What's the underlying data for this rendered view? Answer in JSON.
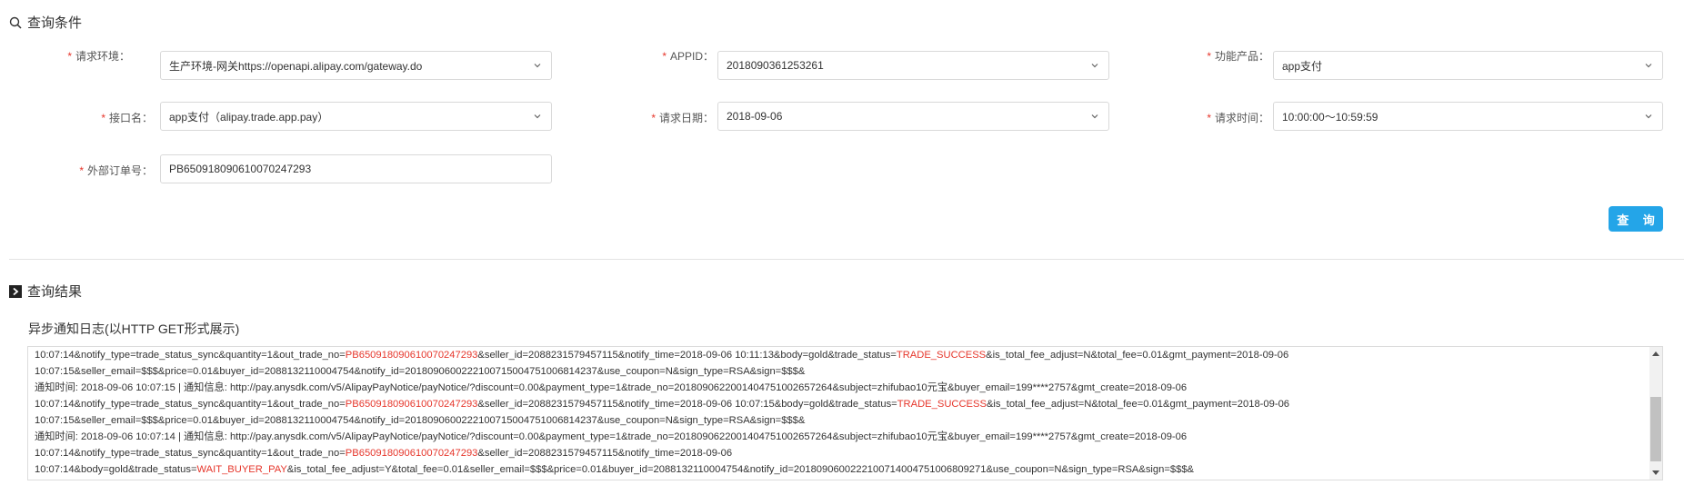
{
  "query_section": {
    "title": "查询条件",
    "fields": [
      {
        "required_mark": "*",
        "label": "请求环境：",
        "value": "生产环境-网关https://openapi.alipay.com/gateway.do",
        "type": "select"
      },
      {
        "required_mark": "*",
        "label": "APPID：",
        "value": "2018090361253261",
        "type": "select"
      },
      {
        "required_mark": "*",
        "label": "功能产品：",
        "value": "app支付",
        "type": "select"
      },
      {
        "required_mark": "*",
        "label": "接口名：",
        "value": "app支付（alipay.trade.app.pay）",
        "type": "select"
      },
      {
        "required_mark": "*",
        "label": "请求日期：",
        "value": "2018-09-06",
        "type": "select"
      },
      {
        "required_mark": "*",
        "label": "请求时间：",
        "value": "10:00:00～10:59:59",
        "type": "select"
      },
      {
        "required_mark": "*",
        "label": "外部订单号：",
        "value": "PB650918090610070247293",
        "type": "input"
      }
    ],
    "query_button": "查 询"
  },
  "result_section": {
    "title": "查询结果",
    "log_label": "异步通知日志(以HTTP GET形式展示)",
    "log_lines": [
      {
        "pre": "10:07:14&notify_type=trade_status_sync&quantity=1&out_trade_no=",
        "hl1": "PB650918090610070247293",
        "mid": "&seller_id=2088231579457115&notify_time=2018-09-06 10:11:13&body=gold&trade_status=",
        "hl2": "TRADE_SUCCESS",
        "post": "&is_total_fee_adjust=N&total_fee=0.01&gmt_payment=2018-09-06"
      },
      {
        "pre": "10:07:15&seller_email=$$$&price=0.01&buyer_id=2088132110004754&notify_id=2018090600222100715004751006814237&use_coupon=N&sign_type=RSA&sign=$$$&",
        "hl1": "",
        "mid": "",
        "hl2": "",
        "post": ""
      },
      {
        "pre": "通知时间: 2018-09-06 10:07:15 | 通知信息: http://pay.anysdk.com/v5/AlipayPayNotice/payNotice/?discount=0.00&payment_type=1&trade_no=2018090622001404751002657264&subject=zhifubao10元宝&buyer_email=199****2757&gmt_create=2018-09-06",
        "hl1": "",
        "mid": "",
        "hl2": "",
        "post": ""
      },
      {
        "pre": "10:07:14&notify_type=trade_status_sync&quantity=1&out_trade_no=",
        "hl1": "PB650918090610070247293",
        "mid": "&seller_id=2088231579457115&notify_time=2018-09-06 10:07:15&body=gold&trade_status=",
        "hl2": "TRADE_SUCCESS",
        "post": "&is_total_fee_adjust=N&total_fee=0.01&gmt_payment=2018-09-06"
      },
      {
        "pre": "10:07:15&seller_email=$$$&price=0.01&buyer_id=2088132110004754&notify_id=2018090600222100715004751006814237&use_coupon=N&sign_type=RSA&sign=$$$&",
        "hl1": "",
        "mid": "",
        "hl2": "",
        "post": ""
      },
      {
        "pre": "通知时间: 2018-09-06 10:07:14 | 通知信息: http://pay.anysdk.com/v5/AlipayPayNotice/payNotice/?discount=0.00&payment_type=1&trade_no=2018090622001404751002657264&subject=zhifubao10元宝&buyer_email=199****2757&gmt_create=2018-09-06",
        "hl1": "",
        "mid": "",
        "hl2": "",
        "post": ""
      },
      {
        "pre": "10:07:14&notify_type=trade_status_sync&quantity=1&out_trade_no=",
        "hl1": "PB650918090610070247293",
        "mid": "&seller_id=2088231579457115&notify_time=2018-09-06",
        "hl2": "",
        "post": ""
      },
      {
        "pre": "10:07:14&body=gold&trade_status=",
        "hl1": "WAIT_BUYER_PAY",
        "mid": "&is_total_fee_adjust=Y&total_fee=0.01&seller_email=$$$&price=0.01&buyer_id=2088132110004754&notify_id=2018090600222100714004751006809271&use_coupon=N&sign_type=RSA&sign=$$$&",
        "hl2": "",
        "post": ""
      }
    ]
  },
  "colors": {
    "required": "#e6362b",
    "highlight": "#e6362b",
    "button": "#24a5e8"
  },
  "icons": {
    "query": "search-icon",
    "result": "chevron-right-box-icon",
    "dropdown": "chevron-down-icon"
  }
}
